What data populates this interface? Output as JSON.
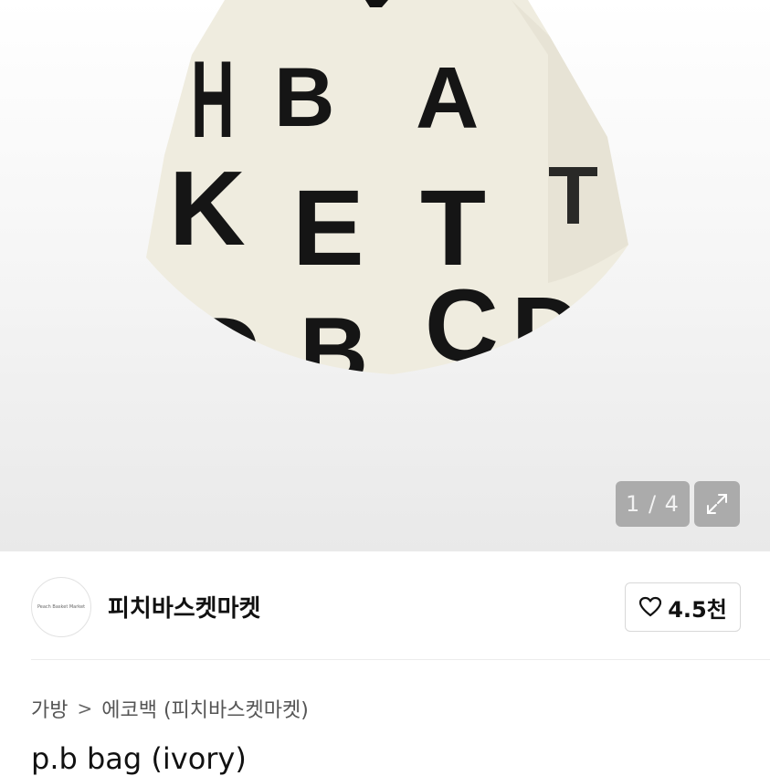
{
  "gallery": {
    "image_letters": [
      "H",
      "B",
      "A",
      "K",
      "E",
      "T",
      "T",
      "B",
      "C",
      "D"
    ],
    "pager": "1 / 4",
    "expand_icon": "expand-icon"
  },
  "seller": {
    "avatar_text": "Peach Basket Market",
    "name": "피치바스켓마켓",
    "like_icon": "heart-icon",
    "like_count": "4.5천"
  },
  "breadcrumb": {
    "level1": "가방",
    "separator": ">",
    "level2": "에코백 (피치바스켓마켓)"
  },
  "product": {
    "title": "p.b bag (ivory)"
  },
  "colors": {
    "bag": "#efecdf",
    "print": "#151515",
    "overlay": "#a0a0a0"
  }
}
